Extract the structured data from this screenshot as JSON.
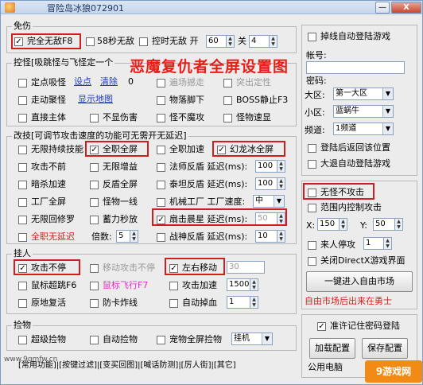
{
  "window": {
    "title": "冒险岛冰狼072901",
    "minimize": "—",
    "close": "X"
  },
  "overlay_title": "恶魔复仇者全屏设置图",
  "invincible": {
    "label": "免伤",
    "full_invincible": "完全无敌F8",
    "sec58": "58秒无敌",
    "control_invincible": "控时无敌 开",
    "open_value": "60",
    "close_label": "关",
    "close_value": "4"
  },
  "control": {
    "label": "控怪[吸跳怪与飞怪定一个",
    "fixed_suck": "定点吸怪",
    "set_point": "设点",
    "clear": "清除",
    "clear_value": "0",
    "walk_gather": "走动聚怪",
    "show_map": "显示地图",
    "attack_main": "直接主体",
    "no_fall": "不显伤害",
    "fall": "物落脚下",
    "boss_stop": "BOSS静止F3",
    "not_attack": "怪不魔攻",
    "monster_speed": "怪物速显",
    "row2_hidden": "遍场撼走",
    "row2_b": "突出定性"
  },
  "skills": {
    "label": "改技[可调节攻击速度的功能可无需开无延迟]",
    "rows": [
      [
        "无限持续技能",
        "全职全屏",
        "全职加速",
        "幻龙冰全屏"
      ],
      [
        "攻击不前",
        "无限增益",
        "法师反盾 延迟(ms):",
        ""
      ],
      [
        "暗杀加速",
        "反盾全屏",
        "泰坦反盾 延迟(ms):",
        ""
      ],
      [
        "工厂全屏",
        "怪物一线",
        "机械工厂 工厂速度:",
        ""
      ],
      [
        "无限回修罗",
        "蓄力秒放",
        "扇击晨星 延迟(ms):",
        ""
      ],
      [
        "全职无延迟",
        "倍数:",
        "战神反盾 延迟(ms):",
        ""
      ]
    ],
    "delay1": "100",
    "delay2": "100",
    "factory_speed": "中",
    "delay3": "50",
    "delay4": "10",
    "multiplier": "5"
  },
  "attack": {
    "label": "挂人",
    "no_stop": "攻击不停",
    "move_no_stop": "移动攻击不停",
    "left_right": "左右移动",
    "left_right_value": "30",
    "mouse_jump": "鼠标超跳F6",
    "mouse_fly": "鼠标飞行F7",
    "attack_speed": "攻击加速",
    "attack_speed_value": "1500",
    "revive": "原地复活",
    "anti_bomb": "防卡炸线",
    "auto_drop": "自动掉血",
    "auto_drop_value": "1"
  },
  "pickup": {
    "label": "捡物",
    "super": "超级捡物",
    "auto": "自动捡物",
    "pet_full": "宠物全屏捡物",
    "mode": "挂机"
  },
  "footer_links": "[常用功能]|[按键过滤]|[变买回图]|[喊话防测]|[厉人街]|[其它]",
  "site_watermark": "www.9gmfw.cn",
  "login": {
    "auto_relogin": "掉线自动登陆游戏",
    "account_label": "帐号:",
    "password_label": "密码:",
    "region_label": "大区:",
    "region_value": "第一大区",
    "subregion_label": "小区:",
    "subregion_value": "蓝蜗牛",
    "channel_label": "频道:",
    "channel_value": "1频道",
    "return_pos": "登陆后返回该位置",
    "auto_login": "大退自动登陆游戏"
  },
  "misc": {
    "no_monster_stop": "无怪不攻击",
    "range_attack": "范围内控制攻击",
    "x_label": "X:",
    "x_value": "150",
    "y_label": "Y:",
    "y_value": "50",
    "stop_on_visitor": "来人停攻",
    "visitor_value": "1",
    "close_directx": "关闭DirectX游戏界面",
    "enter_market": "一键进入自由市场",
    "market_note": "自由市场后出来在勇士"
  },
  "config": {
    "remember_password": "准许记住密码登陆",
    "load": "加载配置",
    "save": "保存配置",
    "public_pc": "公用电脑"
  },
  "brand_badge": "9游戏网"
}
